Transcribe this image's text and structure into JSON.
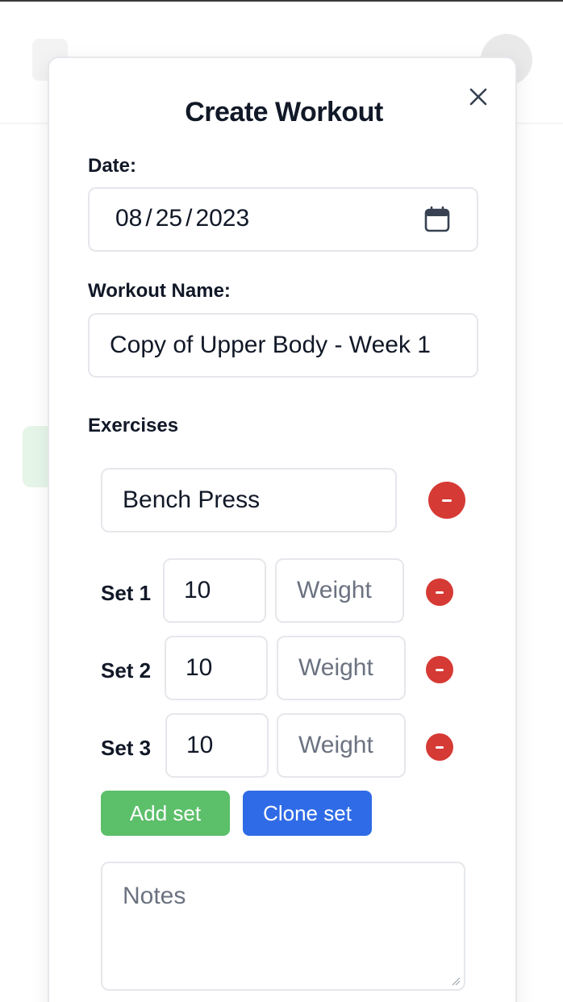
{
  "modal": {
    "title": "Create Workout",
    "close_icon": "close-icon"
  },
  "date": {
    "label": "Date:",
    "month": "08",
    "day": "25",
    "year": "2023",
    "separator": "/",
    "icon": "calendar-icon"
  },
  "workout_name": {
    "label": "Workout Name:",
    "value": "Copy of Upper Body - Week 1"
  },
  "exercises": {
    "heading": "Exercises",
    "items": [
      {
        "name": "Bench Press",
        "sets": [
          {
            "label": "Set 1",
            "reps": "10",
            "weight_placeholder": "Weight"
          },
          {
            "label": "Set 2",
            "reps": "10",
            "weight_placeholder": "Weight"
          },
          {
            "label": "Set 3",
            "reps": "10",
            "weight_placeholder": "Weight"
          }
        ],
        "add_set_label": "Add set",
        "clone_set_label": "Clone set",
        "notes_placeholder": "Notes"
      }
    ]
  },
  "colors": {
    "remove_red": "#d63a35",
    "add_green": "#5cbf6a",
    "clone_blue": "#2f6be6"
  }
}
